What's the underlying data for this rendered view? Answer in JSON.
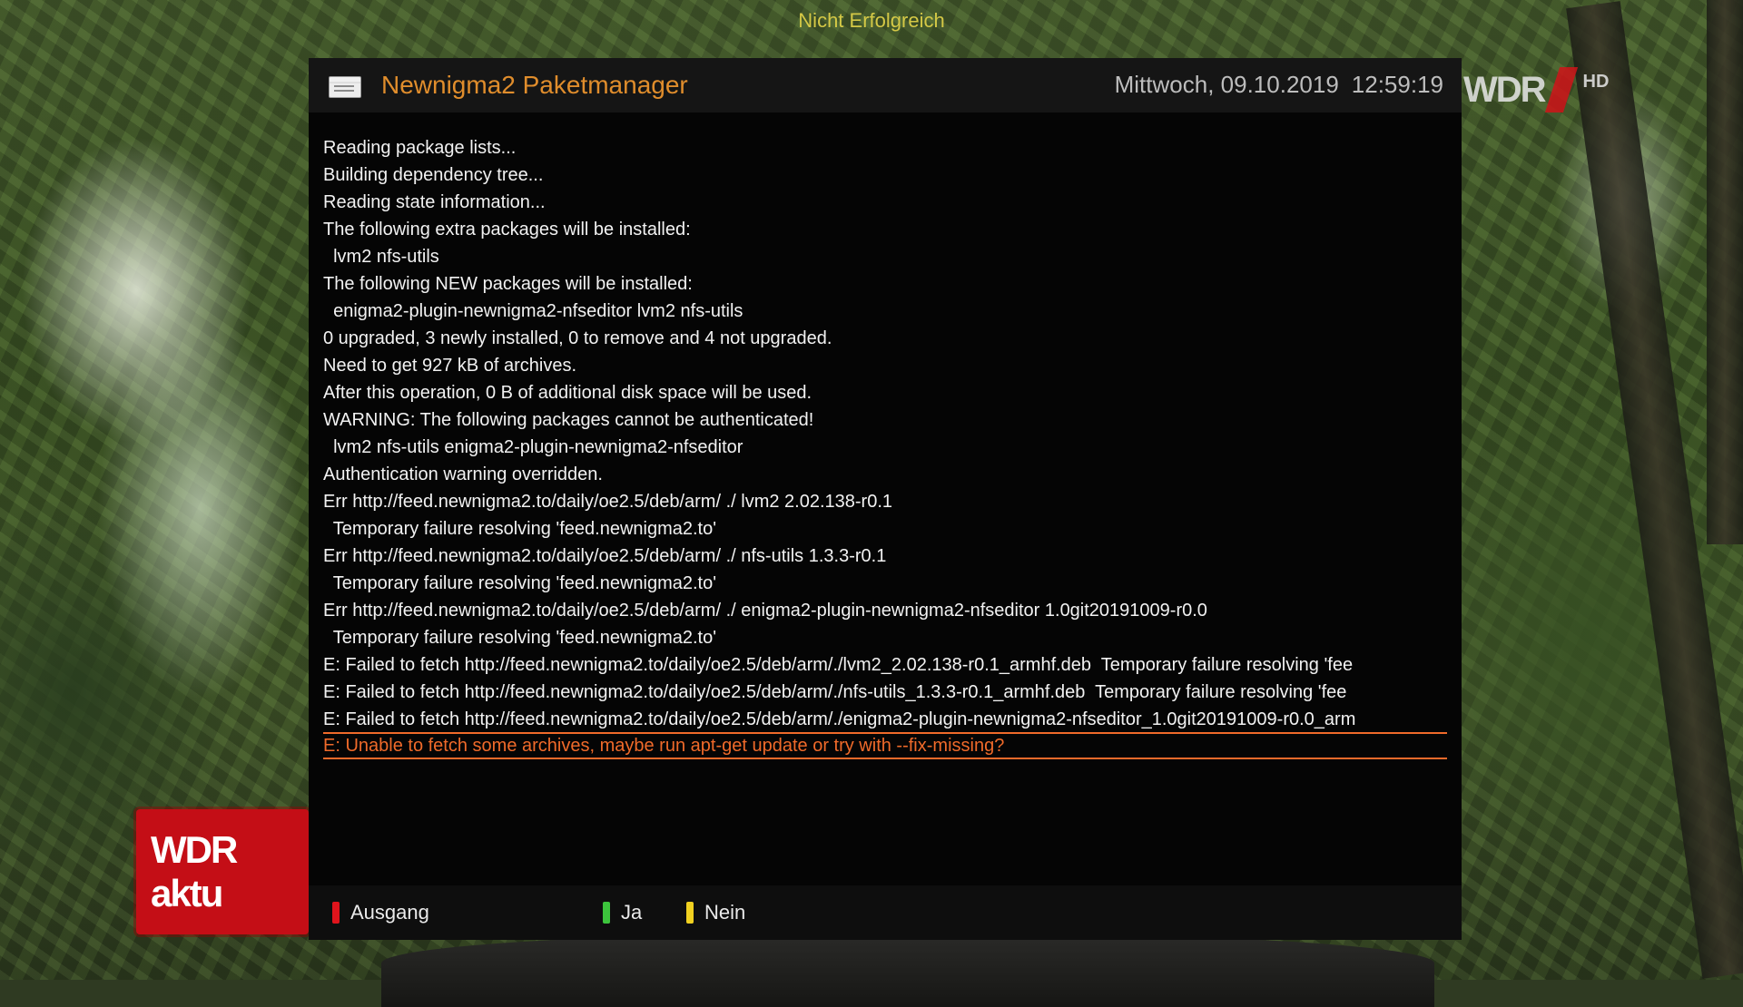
{
  "status_top": "Nicht Erfolgreich",
  "channel_logo": {
    "text": "WDR",
    "hd": "HD"
  },
  "channel_bug": {
    "text": "WDR aktu"
  },
  "header": {
    "title": "Newnigma2 Paketmanager",
    "date": "Mittwoch, 09.10.2019",
    "time": "12:59:19",
    "icon": "package-manager-icon"
  },
  "log_lines": [
    "Reading package lists...",
    "Building dependency tree...",
    "Reading state information...",
    "The following extra packages will be installed:",
    "  lvm2 nfs-utils",
    "The following NEW packages will be installed:",
    "  enigma2-plugin-newnigma2-nfseditor lvm2 nfs-utils",
    "0 upgraded, 3 newly installed, 0 to remove and 4 not upgraded.",
    "Need to get 927 kB of archives.",
    "After this operation, 0 B of additional disk space will be used.",
    "WARNING: The following packages cannot be authenticated!",
    "  lvm2 nfs-utils enigma2-plugin-newnigma2-nfseditor",
    "Authentication warning overridden.",
    "Err http://feed.newnigma2.to/daily/oe2.5/deb/arm/ ./ lvm2 2.02.138-r0.1",
    "  Temporary failure resolving 'feed.newnigma2.to'",
    "Err http://feed.newnigma2.to/daily/oe2.5/deb/arm/ ./ nfs-utils 1.3.3-r0.1",
    "  Temporary failure resolving 'feed.newnigma2.to'",
    "Err http://feed.newnigma2.to/daily/oe2.5/deb/arm/ ./ enigma2-plugin-newnigma2-nfseditor 1.0git20191009-r0.0",
    "  Temporary failure resolving 'feed.newnigma2.to'",
    "E: Failed to fetch http://feed.newnigma2.to/daily/oe2.5/deb/arm/./lvm2_2.02.138-r0.1_armhf.deb  Temporary failure resolving 'fee",
    "E: Failed to fetch http://feed.newnigma2.to/daily/oe2.5/deb/arm/./nfs-utils_1.3.3-r0.1_armhf.deb  Temporary failure resolving 'fee",
    "E: Failed to fetch http://feed.newnigma2.to/daily/oe2.5/deb/arm/./enigma2-plugin-newnigma2-nfseditor_1.0git20191009-r0.0_arm",
    "E: Unable to fetch some archives, maybe run apt-get update or try with --fix-missing?"
  ],
  "selected_line": 22,
  "footer": {
    "buttons": [
      {
        "label": "Ausgang",
        "color": "#e0141c",
        "key": "red"
      },
      {
        "label": "Ja",
        "color": "#3cc43c",
        "key": "green"
      },
      {
        "label": "Nein",
        "color": "#f0d020",
        "key": "yellow"
      }
    ]
  },
  "colors": {
    "title_accent": "#e08d2c",
    "selection": "#f06a2a",
    "status_text": "#d4c846"
  }
}
